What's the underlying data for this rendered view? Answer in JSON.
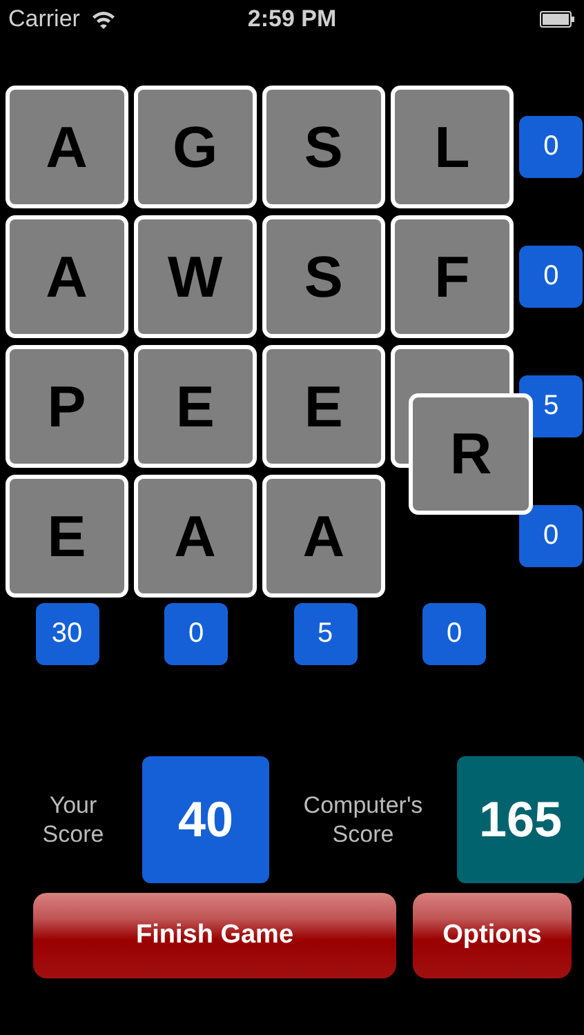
{
  "status_bar": {
    "carrier": "Carrier",
    "time": "2:59 PM"
  },
  "board": {
    "rows": [
      {
        "tiles": [
          {
            "letter": "A"
          },
          {
            "letter": "G"
          },
          {
            "letter": "S"
          },
          {
            "letter": "L"
          }
        ],
        "score": "0"
      },
      {
        "tiles": [
          {
            "letter": "A"
          },
          {
            "letter": "W"
          },
          {
            "letter": "S"
          },
          {
            "letter": "F"
          }
        ],
        "score": "0"
      },
      {
        "tiles": [
          {
            "letter": "P"
          },
          {
            "letter": "E"
          },
          {
            "letter": "E"
          },
          {
            "covered": true
          }
        ],
        "score": "5"
      },
      {
        "tiles": [
          {
            "letter": "E"
          },
          {
            "letter": "A"
          },
          {
            "letter": "A"
          }
        ],
        "score": "0"
      }
    ],
    "column_scores": [
      "30",
      "0",
      "5",
      "0"
    ],
    "dragged_tile": {
      "letter": "R"
    }
  },
  "scores": [
    {
      "label": "Your Score",
      "value": "40",
      "kind": "player"
    },
    {
      "label": "Computer's Score",
      "value": "165",
      "kind": "computer"
    }
  ],
  "buttons": [
    {
      "label": "Finish Game",
      "kind": "wide"
    },
    {
      "label": "Options",
      "kind": "narrow"
    }
  ]
}
